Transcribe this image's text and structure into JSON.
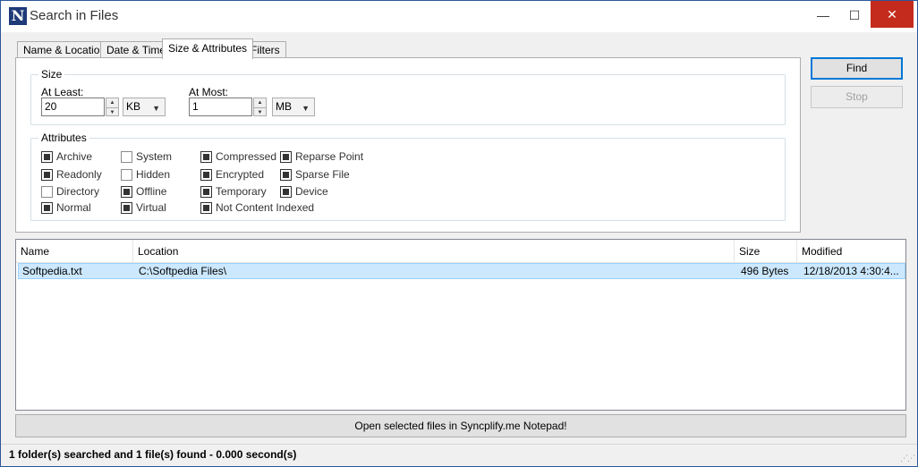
{
  "window": {
    "title": "Search in Files",
    "app_icon_letter": "N"
  },
  "window_controls": {
    "minimize": "—",
    "maximize": "☐",
    "close": "✕"
  },
  "tabs": [
    {
      "label": "Name & Location"
    },
    {
      "label": "Date & Time"
    },
    {
      "label": "Size & Attributes"
    },
    {
      "label": "Filters"
    }
  ],
  "active_tab": "Size & Attributes",
  "size": {
    "group_title": "Size",
    "at_least_label": "At Least:",
    "at_least_value": "20",
    "at_least_unit": "KB",
    "at_most_label": "At Most:",
    "at_most_value": "1",
    "at_most_unit": "MB"
  },
  "attributes": {
    "group_title": "Attributes",
    "items": [
      {
        "label": "Archive",
        "checked": true
      },
      {
        "label": "Readonly",
        "checked": true
      },
      {
        "label": "Directory",
        "checked": false
      },
      {
        "label": "Normal",
        "checked": true
      },
      {
        "label": "System",
        "checked": false
      },
      {
        "label": "Hidden",
        "checked": false
      },
      {
        "label": "Offline",
        "checked": true
      },
      {
        "label": "Virtual",
        "checked": true
      },
      {
        "label": "Compressed",
        "checked": true
      },
      {
        "label": "Encrypted",
        "checked": true
      },
      {
        "label": "Temporary",
        "checked": true
      },
      {
        "label": "Not Content Indexed",
        "checked": true
      },
      {
        "label": "Reparse Point",
        "checked": true
      },
      {
        "label": "Sparse File",
        "checked": true
      },
      {
        "label": "Device",
        "checked": true
      }
    ]
  },
  "buttons": {
    "find": "Find",
    "stop": "Stop",
    "open_selected": "Open selected files in Syncplify.me Notepad!"
  },
  "results": {
    "columns": [
      "Name",
      "Location",
      "Size",
      "Modified"
    ],
    "rows": [
      {
        "name": "Softpedia.txt",
        "location": "C:\\Softpedia Files\\",
        "size": "496 Bytes",
        "modified": "12/18/2013 4:30:4..."
      }
    ]
  },
  "status": {
    "text": "1 folder(s) searched and 1 file(s) found - 0.000 second(s)"
  }
}
